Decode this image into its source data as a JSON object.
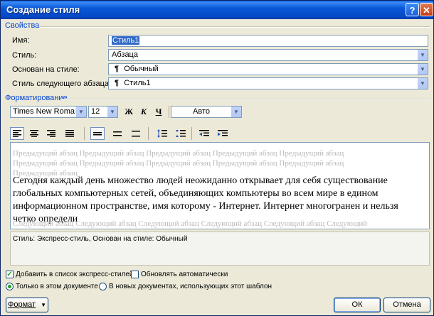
{
  "window": {
    "title": "Создание стиля",
    "help": "?",
    "close": "✕"
  },
  "properties": {
    "section_label": "Свойства",
    "name_label": "Имя:",
    "name_value": "Стиль1",
    "style_label": "Стиль:",
    "style_value": "Абзаца",
    "based_label": "Основан на стиле:",
    "based_value": "Обычный",
    "next_label": "Стиль следующего абзаца:",
    "next_value": "Стиль1"
  },
  "formatting": {
    "section_label": "Форматирование",
    "font": "Times New Roman",
    "size": "12",
    "bold": "Ж",
    "italic": "К",
    "underline": "Ч",
    "color": "Авто"
  },
  "preview": {
    "previous": "Предыдущий абзац Предыдущий абзац Предыдущий абзац Предыдущий абзац Предыдущий абзац Предыдущий абзац Предыдущий абзац Предыдущий абзац Предыдущий абзац Предыдущий абзац Предыдущий абзац",
    "sample": "Сегодня каждый день множество людей неожиданно открывает для себя существование глобальных компьютерных сетей, объединяющих компьютеры во всем мире в едином информационном пространстве, имя которому - Интернет. Интернет многогранен и нельзя четко определи",
    "next": "Следующий абзац Следующий абзац Следующий абзац Следующий абзац Следующий абзац Следующий"
  },
  "description": "Стиль: Экспресс-стиль, Основан на стиле: Обычный",
  "options": {
    "add_quick": "Добавить в список экспресс-стилей",
    "auto_update": "Обновлять автоматически",
    "only_doc": "Только в этом документе",
    "new_docs": "В новых документах, использующих этот шаблон"
  },
  "buttons": {
    "format": "Формат",
    "ok": "ОК",
    "cancel": "Отмена"
  },
  "colors": {
    "title_bar": "#0a58d8",
    "section": "#0046d5",
    "check": "#21a121"
  }
}
